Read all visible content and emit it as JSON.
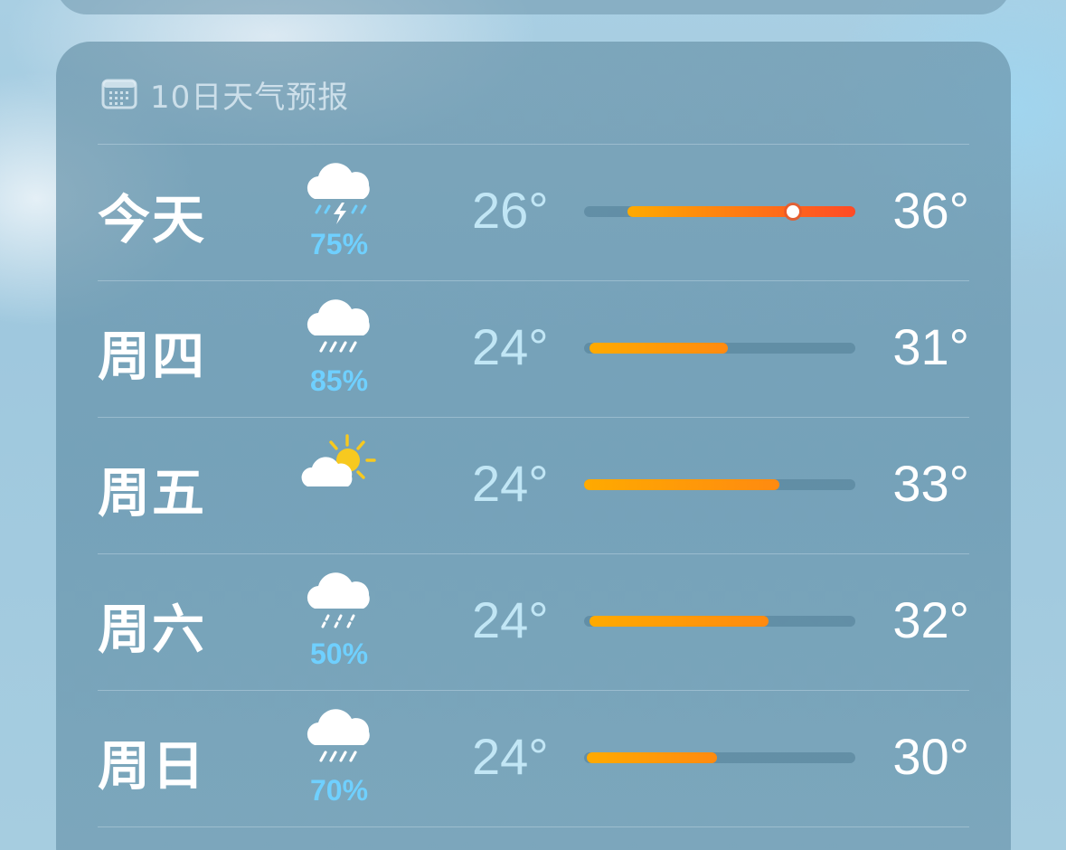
{
  "header": {
    "title": "10日天气预报",
    "icon": "calendar-icon"
  },
  "accent": {
    "rain_percent": "#6fd0ff",
    "bar_start": "#ffaa00",
    "bar_end": "#ff4a26"
  },
  "days": [
    {
      "day": "今天",
      "icon": "thunderstorm-icon",
      "precip": "75%",
      "low": "26°",
      "high": "36°",
      "bar_start": 0.16,
      "bar_end": 1.0,
      "current_position": 0.77
    },
    {
      "day": "周四",
      "icon": "rain-icon",
      "precip": "85%",
      "low": "24°",
      "high": "31°",
      "bar_start": 0.02,
      "bar_end": 0.53
    },
    {
      "day": "周五",
      "icon": "partly-cloudy-icon",
      "precip": "",
      "low": "24°",
      "high": "33°",
      "bar_start": 0.0,
      "bar_end": 0.72
    },
    {
      "day": "周六",
      "icon": "light-rain-icon",
      "precip": "50%",
      "low": "24°",
      "high": "32°",
      "bar_start": 0.02,
      "bar_end": 0.68
    },
    {
      "day": "周日",
      "icon": "rain-icon",
      "precip": "70%",
      "low": "24°",
      "high": "30°",
      "bar_start": 0.01,
      "bar_end": 0.49
    }
  ]
}
